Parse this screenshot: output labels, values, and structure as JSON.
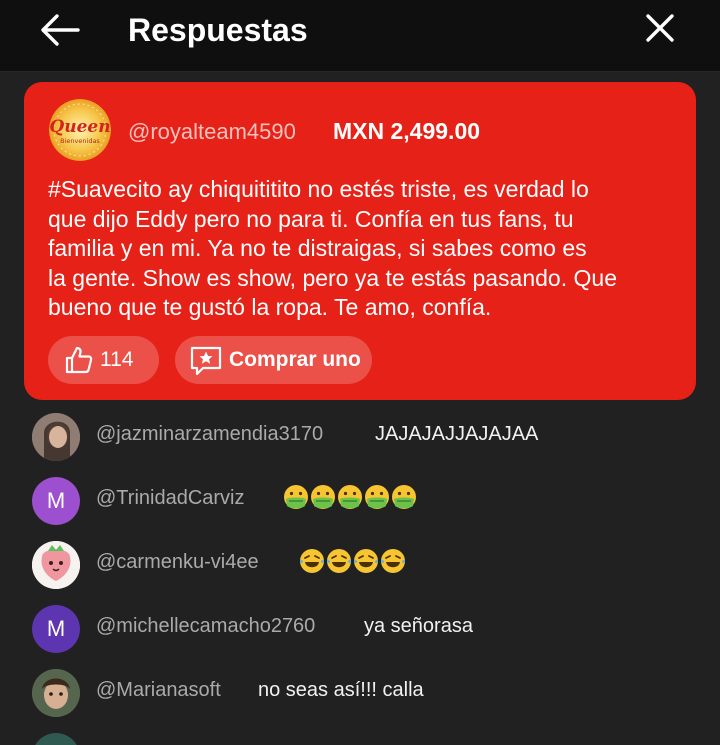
{
  "header": {
    "title": "Respuestas",
    "back_icon": "arrow-left-icon",
    "close_icon": "close-icon"
  },
  "superchat": {
    "avatar_text": "Queen",
    "avatar_subtext": "Bienvenidas",
    "username": "@royalteam4590",
    "amount": "MXN 2,499.00",
    "message_lines": [
      "#Suavecito ay chiquititito no estés triste, es verdad lo",
      "que dijo Eddy pero no para ti. Confía en tus fans, tu",
      "familia y en mi. Ya no te distraigas, si sabes como es",
      "la gente. Show es show, pero ya te estás pasando. Que",
      "bueno que te gustó la ropa. Te amo, confía."
    ],
    "like_count": "114",
    "buy_label": "Comprar uno",
    "bg_color": "#e62117"
  },
  "comments": [
    {
      "username": "@jazminarzamendia3170",
      "text": "JAJAJAJJAJAJAA",
      "avatar_initial": "",
      "avatar_color": "#6b5b55"
    },
    {
      "username": "@TrinidadCarviz",
      "text": "",
      "emoji": "sick-face-emoji",
      "emoji_count": 5,
      "avatar_initial": "M",
      "avatar_color": "#8e44c4"
    },
    {
      "username": "@carmenku-vi4ee",
      "text": "",
      "emoji": "laughing-tears-emoji",
      "emoji_count": 4,
      "avatar_initial": "",
      "avatar_color": "#f4f4f4"
    },
    {
      "username": "@michellecamacho2760",
      "text": "ya señorasa",
      "avatar_initial": "M",
      "avatar_color": "#5e35b1"
    },
    {
      "username": "@Marianasoft",
      "text": "no seas así!!! calla",
      "avatar_initial": "",
      "avatar_color": "#3f4a3a"
    }
  ]
}
